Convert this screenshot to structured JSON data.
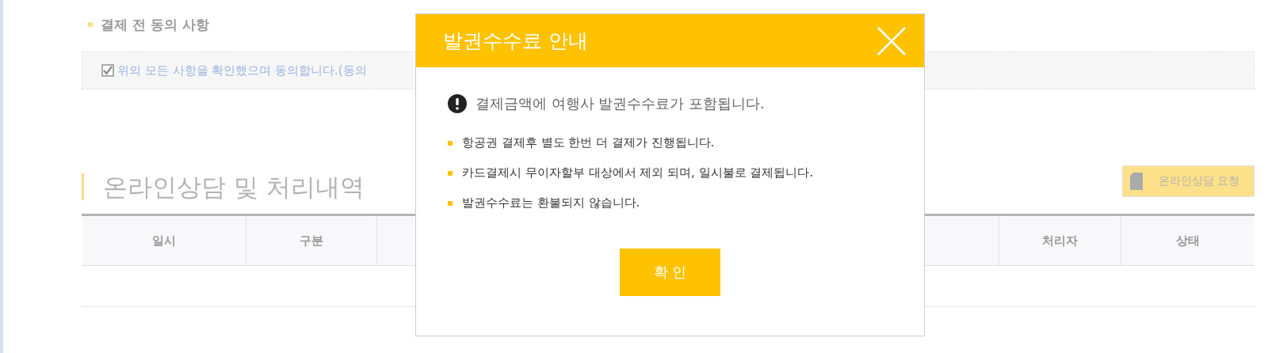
{
  "agreement_section": {
    "title": "결제 전 동의 사항",
    "agreement": {
      "label": "위의 모든 사항을 확인했으며 동의합니다.(동의",
      "checked": true
    }
  },
  "consultation": {
    "title": "온라인상담 및 처리내역",
    "request_button": "온라인상담 요청",
    "table": {
      "columns": [
        "일시",
        "구분",
        "",
        "",
        "처리자",
        "상태"
      ]
    }
  },
  "modal": {
    "title": "발권수수료 안내",
    "message": "결제금액에 여행사 발권수수료가 포함됩니다.",
    "notes": [
      "항공권 결제후 별도 한번 더 결제가 진행됩니다.",
      "카드결제시 무이자할부 대상에서 제외 되며, 일시불로 결제됩니다.",
      "발권수수료는 환불되지 않습니다."
    ],
    "confirm_button": "확 인"
  }
}
